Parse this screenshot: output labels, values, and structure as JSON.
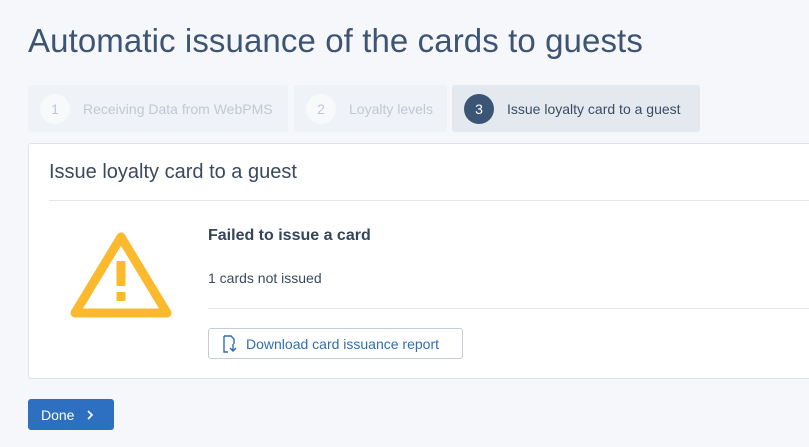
{
  "page": {
    "title": "Automatic issuance of the cards to guests"
  },
  "steps": [
    {
      "number": "1",
      "label": "Receiving Data from WebPMS",
      "state": "completed"
    },
    {
      "number": "2",
      "label": "Loyalty levels",
      "state": "completed"
    },
    {
      "number": "3",
      "label": "Issue loyalty card to a guest",
      "state": "active"
    }
  ],
  "card": {
    "title": "Issue loyalty card to a guest",
    "icon": "warning-triangle-icon",
    "result_title": "Failed to issue a card",
    "result_detail": "1 cards not issued",
    "download_label": "Download card issuance report",
    "download_icon": "download-file-icon"
  },
  "footer": {
    "done_label": "Done",
    "done_icon": "chevron-right-icon"
  },
  "colors": {
    "accent": "#2d6fc1",
    "warning": "#fbb92e",
    "active_step": "#3b5675",
    "title": "#3d5473"
  }
}
